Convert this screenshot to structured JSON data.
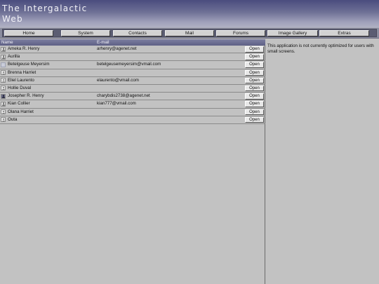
{
  "app": {
    "title_line1": "The Intergalactic",
    "title_line2": "Web"
  },
  "nav": {
    "items": [
      {
        "label": "Home"
      },
      {
        "label": "System"
      },
      {
        "label": "Contacts"
      },
      {
        "label": "Mail"
      },
      {
        "label": "Forums"
      },
      {
        "label": "Image Gallery"
      },
      {
        "label": "Extras"
      }
    ]
  },
  "table": {
    "headers": {
      "name": "Name",
      "email": "E-mail"
    },
    "open_label": "Open",
    "rows": [
      {
        "name": "Ameka R. Henry",
        "email": "arhenry@agenet.net",
        "icon": "person-icon"
      },
      {
        "name": "Aurilla",
        "email": "",
        "icon": "person-icon"
      },
      {
        "name": "Betelgeuse Meyersim",
        "email": "betelgeusemeyersim@vmail.com",
        "icon": "blank-avatar-icon"
      },
      {
        "name": "Brenna Harriet",
        "email": "",
        "icon": "person-icon"
      },
      {
        "name": "Eliel Laurento",
        "email": "elaurento@vmail.com",
        "icon": "person-icon"
      },
      {
        "name": "Hollie Duval",
        "email": "",
        "icon": "person-icon"
      },
      {
        "name": "Josepher R. Henry",
        "email": "charybdis2738@agenet.net",
        "icon": "photo-avatar-icon"
      },
      {
        "name": "Kian Collier",
        "email": "kian777@vmail.com",
        "icon": "person-icon"
      },
      {
        "name": "Olana Harriet",
        "email": "",
        "icon": "person-icon"
      },
      {
        "name": "Outa",
        "email": "",
        "icon": "person-icon"
      }
    ]
  },
  "notice": {
    "text": "This application is not currently optimized for users with small screens."
  },
  "colors": {
    "header_dark": "#4a4c7e",
    "header_light": "#b0b1c3",
    "background": "#c2c2c2"
  }
}
